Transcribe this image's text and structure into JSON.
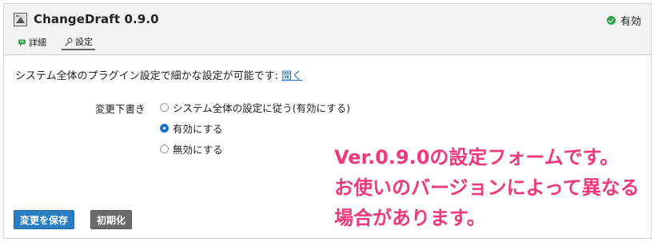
{
  "header": {
    "plugin_icon": "plugin-page-icon",
    "title": "ChangeDraft 0.9.0",
    "status_label": "有効",
    "status_color": "#2ea44f",
    "tabs": [
      {
        "label": "詳細",
        "icon": "comment-icon",
        "active": false
      },
      {
        "label": "設定",
        "icon": "wrench-icon",
        "active": true
      }
    ]
  },
  "settings": {
    "description": "システム全体のプラグイン設定で細かな設定が可能です:",
    "open_link": "開く",
    "field_label": "変更下書き",
    "options": [
      {
        "label": "システム全体の設定に従う(有効にする)",
        "checked": false
      },
      {
        "label": "有効にする",
        "checked": true
      },
      {
        "label": "無効にする",
        "checked": false
      }
    ]
  },
  "buttons": {
    "save": "変更を保存",
    "reset": "初期化",
    "save_color": "#2b7ec1",
    "reset_color": "#6b6b6b"
  },
  "annotation": {
    "lines": [
      "Ver.0.9.0の設定フォームです。",
      "お使いのバージョンによって異なる",
      "場合があります。"
    ],
    "color": "#ec3a7c"
  }
}
